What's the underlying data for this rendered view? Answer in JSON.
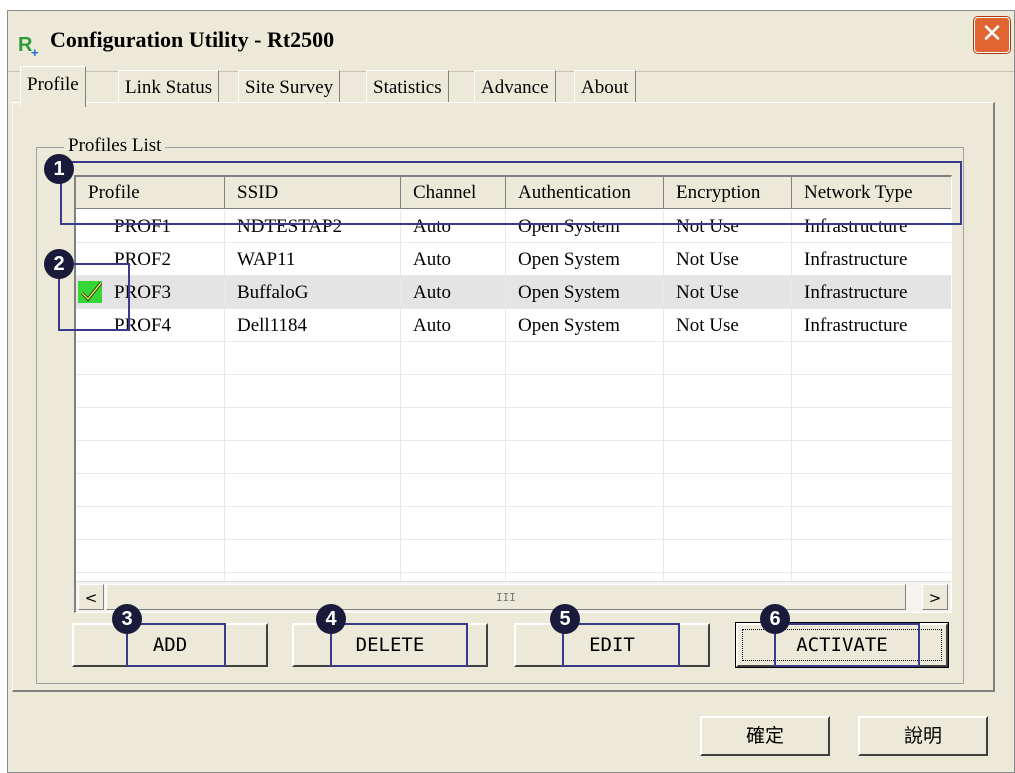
{
  "window": {
    "title": "Configuration Utility - Rt2500",
    "close_glyph": "✕",
    "icon_letter": "R",
    "icon_plus": "+"
  },
  "tabs": [
    {
      "label": "Profile"
    },
    {
      "label": "Link Status"
    },
    {
      "label": "Site Survey"
    },
    {
      "label": "Statistics"
    },
    {
      "label": "Advance"
    },
    {
      "label": "About"
    }
  ],
  "profiles_list": {
    "legend": "Profiles List",
    "columns": [
      "Profile",
      "SSID",
      "Channel",
      "Authentication",
      "Encryption",
      "Network Type"
    ],
    "rows": [
      {
        "profile": "PROF1",
        "ssid": "NDTESTAP2",
        "channel": "Auto",
        "auth": "Open System",
        "enc": "Not Use",
        "net": "Infrastructure"
      },
      {
        "profile": "PROF2",
        "ssid": "WAP11",
        "channel": "Auto",
        "auth": "Open System",
        "enc": "Not Use",
        "net": "Infrastructure"
      },
      {
        "profile": "PROF3",
        "ssid": "BuffaloG",
        "channel": "Auto",
        "auth": "Open System",
        "enc": "Not Use",
        "net": "Infrastructure",
        "active": true
      },
      {
        "profile": "PROF4",
        "ssid": "Dell1184",
        "channel": "Auto",
        "auth": "Open System",
        "enc": "Not Use",
        "net": "Infrastructure"
      }
    ],
    "scroll_left": "<",
    "scroll_right": ">",
    "scroll_grip": "III"
  },
  "buttons": {
    "add": "ADD",
    "delete": "DELETE",
    "edit": "EDIT",
    "activate": "ACTIVATE",
    "ok": "確定",
    "help": "說明"
  },
  "callouts": [
    "1",
    "2",
    "3",
    "4",
    "5",
    "6"
  ],
  "icons": {
    "active_profile": "check-icon",
    "close": "close-icon",
    "app": "app-icon"
  },
  "colors": {
    "check_bg": "#35d635",
    "callout_bg": "#1a1a3a",
    "highlight": "#3a3a8c",
    "close_bg": "#e0642f"
  }
}
